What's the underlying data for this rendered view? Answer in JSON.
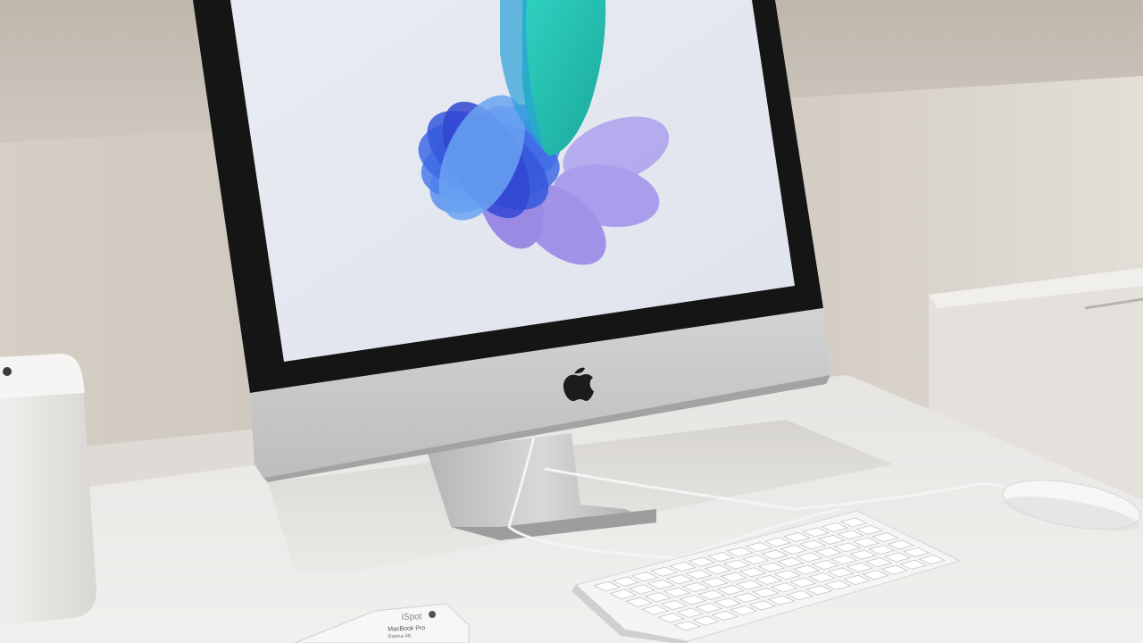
{
  "scene": {
    "description_free": true,
    "colors": {
      "wall": "#cfc8bf",
      "table": "#ecebe8",
      "bezel": "#1a1a1a",
      "screen": "#e6e9f0",
      "chin": "#c9c9c9",
      "accent_teal": "#2ec4b6",
      "accent_blue": "#3d6ee0",
      "accent_violet": "#6b3ee6"
    }
  },
  "placard": {
    "brand": "iSpot",
    "name": "MacBook Pro",
    "subtitle": "Retina 4K"
  },
  "icons": {
    "logo": "apple-logo-icon"
  }
}
